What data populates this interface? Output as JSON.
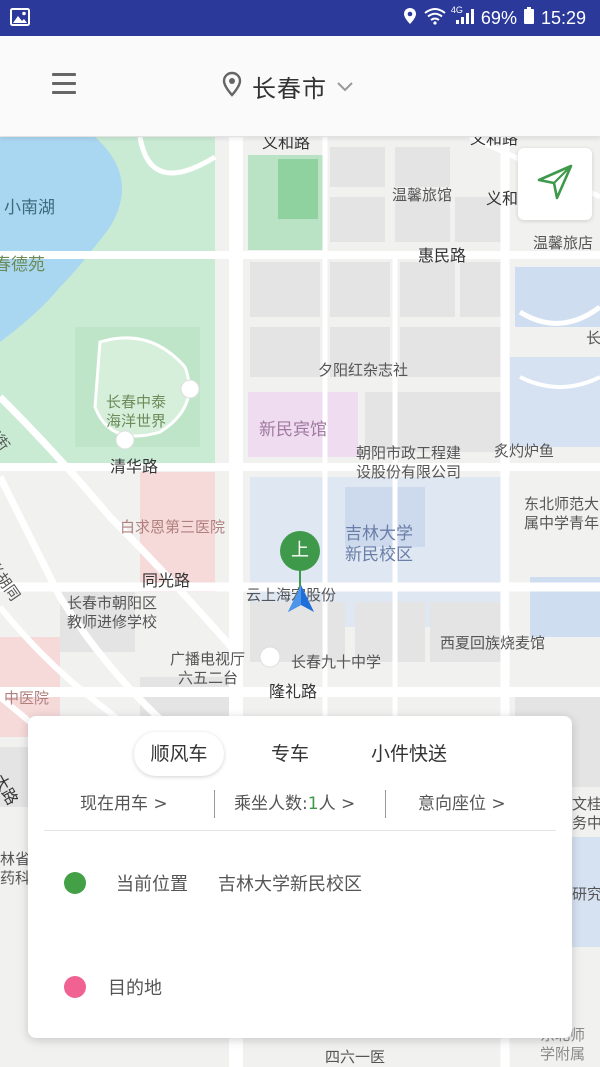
{
  "status_bar": {
    "battery": "69%",
    "time": "15:29",
    "network": "4G"
  },
  "header": {
    "city": "长春市"
  },
  "map": {
    "labels": [
      {
        "id": "yihe-road-1",
        "text": "义和路"
      },
      {
        "id": "yihe-road-2",
        "text": "义和路"
      },
      {
        "id": "yihe-3",
        "text": "义和"
      },
      {
        "id": "xiaonan-lake",
        "text": "小南湖"
      },
      {
        "id": "chundeyuan",
        "text": "春德苑"
      },
      {
        "id": "wenxin-1",
        "text": "温馨旅馆"
      },
      {
        "id": "wenxin-2",
        "text": "温馨旅店"
      },
      {
        "id": "huimin-road",
        "text": "惠民路"
      },
      {
        "id": "chang-de",
        "text": "长德"
      },
      {
        "id": "xiyanghong",
        "text": "夕阳红杂志社"
      },
      {
        "id": "haiyang-1",
        "text": "长春中泰"
      },
      {
        "id": "haiyang-2",
        "text": "海洋世界"
      },
      {
        "id": "baojie",
        "text": "宝街"
      },
      {
        "id": "xinmin-hotel",
        "text": "新民宾馆"
      },
      {
        "id": "chaoyang-eng-1",
        "text": "朝阳市政工程建"
      },
      {
        "id": "chaoyang-eng-2",
        "text": "设股份有限公司"
      },
      {
        "id": "zhiyu",
        "text": "炙灼炉鱼"
      },
      {
        "id": "qinghua-road",
        "text": "清华路"
      },
      {
        "id": "dongbei-1",
        "text": "东北师范大"
      },
      {
        "id": "dongbei-2",
        "text": "属中学青年"
      },
      {
        "id": "baiqiuen",
        "text": "白求恩第三医院"
      },
      {
        "id": "jilin-1",
        "text": "吉林大学"
      },
      {
        "id": "jilin-2",
        "text": "新民校区"
      },
      {
        "id": "guangguang",
        "text": "光胡同"
      },
      {
        "id": "tongguang-road",
        "text": "同光路"
      },
      {
        "id": "yunshang",
        "text": "云上海宏股份"
      },
      {
        "id": "teacher-1",
        "text": "长春市朝阳区"
      },
      {
        "id": "teacher-2",
        "text": "教师进修学校"
      },
      {
        "id": "xixia",
        "text": "西夏回族烧麦馆"
      },
      {
        "id": "guangbo-1",
        "text": "广播电视厅"
      },
      {
        "id": "guangbo-2",
        "text": "六五二台"
      },
      {
        "id": "no90",
        "text": "长春九十中学"
      },
      {
        "id": "longli-road",
        "text": "隆礼路"
      },
      {
        "id": "zhongyi",
        "text": "中医院"
      },
      {
        "id": "dalu",
        "text": "大路"
      },
      {
        "id": "lin-1",
        "text": "林省"
      },
      {
        "id": "lin-2",
        "text": "药科学"
      },
      {
        "id": "wengui-1",
        "text": "文桂"
      },
      {
        "id": "wengui-2",
        "text": "务中"
      },
      {
        "id": "yanjiu",
        "text": "研究"
      },
      {
        "id": "dongbeishi-1",
        "text": "东北师"
      },
      {
        "id": "dongbeishi-2",
        "text": "学附属"
      },
      {
        "id": "siliuyi",
        "text": "四六一医"
      }
    ],
    "pin_label": "上"
  },
  "card": {
    "tabs": [
      {
        "label": "顺风车"
      },
      {
        "label": "专车"
      },
      {
        "label": "小件快送"
      }
    ],
    "options": {
      "time": "现在用车  >",
      "passengers_prefix": "乘坐人数:",
      "passengers_value": "1",
      "passengers_suffix": "人 >",
      "seat": "意向座位    >"
    },
    "origin": {
      "key": "当前位置",
      "value": "吉林大学新民校区",
      "color": "#43a047"
    },
    "destination": {
      "key": "目的地",
      "color": "#f06292"
    }
  },
  "colors": {
    "status_bar": "#2b3a9a",
    "accent_green": "#3e9a4a",
    "destination_pink": "#f06292"
  }
}
